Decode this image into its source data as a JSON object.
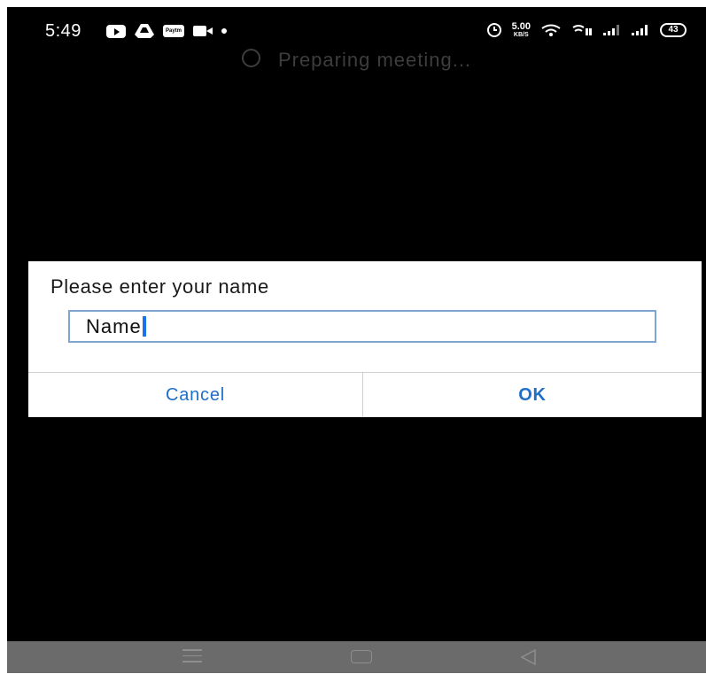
{
  "status_bar": {
    "time": "5:49",
    "left_icons": [
      "youtube-icon",
      "drive-icon",
      "paytm-icon",
      "video-camera-icon",
      "notification-dot-icon"
    ],
    "paytm_label": "Paytm",
    "network_speed": "5.00",
    "network_speed_unit": "KB/S",
    "right_icons": [
      "alarm-icon",
      "wifi-icon",
      "volte-icon",
      "signal-icon",
      "signal-icon",
      "battery-icon"
    ],
    "battery_level": "43"
  },
  "background_status": {
    "text": "Preparing meeting..."
  },
  "dialog": {
    "title": "Please enter your name",
    "input_value": "Name",
    "cancel_label": "Cancel",
    "ok_label": "OK"
  },
  "nav_bar": {
    "buttons": [
      "menu-icon",
      "home-icon",
      "back-icon"
    ]
  },
  "colors": {
    "background": "#000000",
    "accent": "#1f6fc6",
    "input_border": "#7ea6d1",
    "caret": "#1a73e8",
    "nav_bar": "#6b6b6b"
  }
}
